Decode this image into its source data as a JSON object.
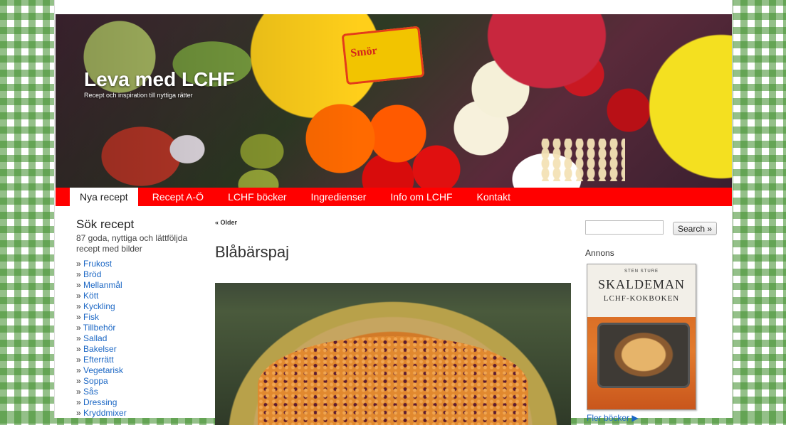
{
  "site": {
    "title": "Leva med LCHF",
    "tagline": "Recept och inspiration till nyttiga rätter",
    "butter_text": "Smör"
  },
  "nav": {
    "items": [
      {
        "label": "Nya recept",
        "active": true
      },
      {
        "label": "Recept A-Ö",
        "active": false
      },
      {
        "label": "LCHF böcker",
        "active": false
      },
      {
        "label": "Ingredienser",
        "active": false
      },
      {
        "label": "Info om LCHF",
        "active": false
      },
      {
        "label": "Kontakt",
        "active": false
      }
    ]
  },
  "sidebar": {
    "heading": "Sök recept",
    "description": "87 goda, nyttiga och lättföljda recept med bilder",
    "categories": [
      "Frukost",
      "Bröd",
      "Mellanmål",
      "Kött",
      "Kyckling",
      "Fisk",
      "Tillbehör",
      "Sallad",
      "Bakelser",
      "Efterrätt",
      "Vegetarisk",
      "Soppa",
      "Sås",
      "Dressing",
      "Kryddmixer"
    ]
  },
  "main": {
    "older_link": "« Older",
    "post_title": "Blåbärspaj"
  },
  "right": {
    "search_value": "",
    "search_button": "Search »",
    "annons_label": "Annons",
    "book_author": "STEN STURE",
    "book_title": "SKALDEMAN",
    "book_subtitle": "LCHF-KOKBOKEN",
    "more_books": "Fler böcker ▶"
  },
  "colors": {
    "nav_red": "#ff0000",
    "link_blue": "#1a66c4",
    "gingham_green": "#3c8c28"
  }
}
